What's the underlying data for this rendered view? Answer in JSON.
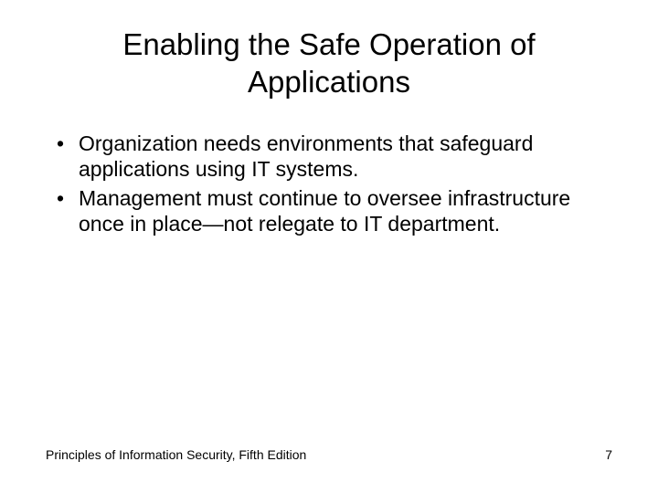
{
  "slide": {
    "title": "Enabling the Safe Operation of Applications",
    "bullets": [
      "Organization needs environments that safeguard applications using IT systems.",
      "Management must continue to oversee infrastructure once in place—not relegate to IT department."
    ],
    "footer": {
      "left": "Principles of Information Security, Fifth Edition",
      "right": "7"
    }
  }
}
